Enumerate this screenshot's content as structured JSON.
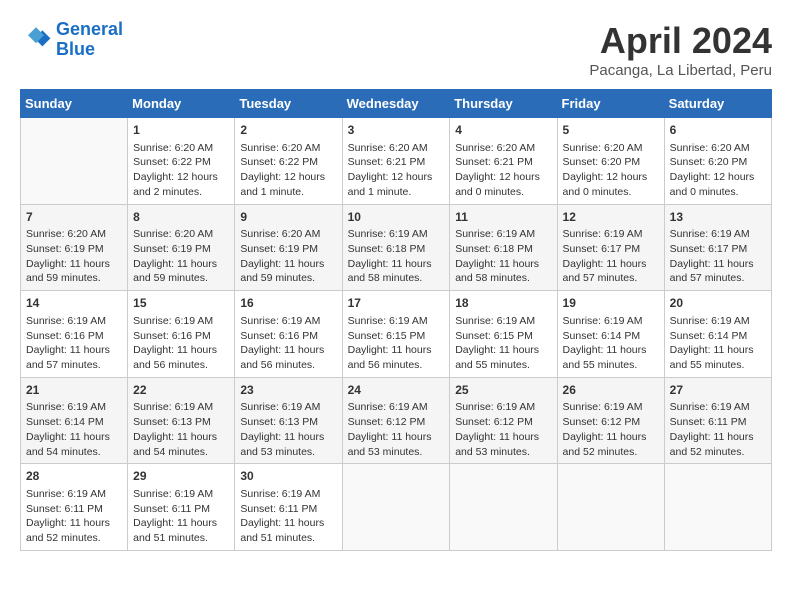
{
  "header": {
    "logo_line1": "General",
    "logo_line2": "Blue",
    "month": "April 2024",
    "location": "Pacanga, La Libertad, Peru"
  },
  "weekdays": [
    "Sunday",
    "Monday",
    "Tuesday",
    "Wednesday",
    "Thursday",
    "Friday",
    "Saturday"
  ],
  "weeks": [
    [
      {
        "day": "",
        "info": ""
      },
      {
        "day": "1",
        "info": "Sunrise: 6:20 AM\nSunset: 6:22 PM\nDaylight: 12 hours\nand 2 minutes."
      },
      {
        "day": "2",
        "info": "Sunrise: 6:20 AM\nSunset: 6:22 PM\nDaylight: 12 hours\nand 1 minute."
      },
      {
        "day": "3",
        "info": "Sunrise: 6:20 AM\nSunset: 6:21 PM\nDaylight: 12 hours\nand 1 minute."
      },
      {
        "day": "4",
        "info": "Sunrise: 6:20 AM\nSunset: 6:21 PM\nDaylight: 12 hours\nand 0 minutes."
      },
      {
        "day": "5",
        "info": "Sunrise: 6:20 AM\nSunset: 6:20 PM\nDaylight: 12 hours\nand 0 minutes."
      },
      {
        "day": "6",
        "info": "Sunrise: 6:20 AM\nSunset: 6:20 PM\nDaylight: 12 hours\nand 0 minutes."
      }
    ],
    [
      {
        "day": "7",
        "info": "Sunrise: 6:20 AM\nSunset: 6:19 PM\nDaylight: 11 hours\nand 59 minutes."
      },
      {
        "day": "8",
        "info": "Sunrise: 6:20 AM\nSunset: 6:19 PM\nDaylight: 11 hours\nand 59 minutes."
      },
      {
        "day": "9",
        "info": "Sunrise: 6:20 AM\nSunset: 6:19 PM\nDaylight: 11 hours\nand 59 minutes."
      },
      {
        "day": "10",
        "info": "Sunrise: 6:19 AM\nSunset: 6:18 PM\nDaylight: 11 hours\nand 58 minutes."
      },
      {
        "day": "11",
        "info": "Sunrise: 6:19 AM\nSunset: 6:18 PM\nDaylight: 11 hours\nand 58 minutes."
      },
      {
        "day": "12",
        "info": "Sunrise: 6:19 AM\nSunset: 6:17 PM\nDaylight: 11 hours\nand 57 minutes."
      },
      {
        "day": "13",
        "info": "Sunrise: 6:19 AM\nSunset: 6:17 PM\nDaylight: 11 hours\nand 57 minutes."
      }
    ],
    [
      {
        "day": "14",
        "info": "Sunrise: 6:19 AM\nSunset: 6:16 PM\nDaylight: 11 hours\nand 57 minutes."
      },
      {
        "day": "15",
        "info": "Sunrise: 6:19 AM\nSunset: 6:16 PM\nDaylight: 11 hours\nand 56 minutes."
      },
      {
        "day": "16",
        "info": "Sunrise: 6:19 AM\nSunset: 6:16 PM\nDaylight: 11 hours\nand 56 minutes."
      },
      {
        "day": "17",
        "info": "Sunrise: 6:19 AM\nSunset: 6:15 PM\nDaylight: 11 hours\nand 56 minutes."
      },
      {
        "day": "18",
        "info": "Sunrise: 6:19 AM\nSunset: 6:15 PM\nDaylight: 11 hours\nand 55 minutes."
      },
      {
        "day": "19",
        "info": "Sunrise: 6:19 AM\nSunset: 6:14 PM\nDaylight: 11 hours\nand 55 minutes."
      },
      {
        "day": "20",
        "info": "Sunrise: 6:19 AM\nSunset: 6:14 PM\nDaylight: 11 hours\nand 55 minutes."
      }
    ],
    [
      {
        "day": "21",
        "info": "Sunrise: 6:19 AM\nSunset: 6:14 PM\nDaylight: 11 hours\nand 54 minutes."
      },
      {
        "day": "22",
        "info": "Sunrise: 6:19 AM\nSunset: 6:13 PM\nDaylight: 11 hours\nand 54 minutes."
      },
      {
        "day": "23",
        "info": "Sunrise: 6:19 AM\nSunset: 6:13 PM\nDaylight: 11 hours\nand 53 minutes."
      },
      {
        "day": "24",
        "info": "Sunrise: 6:19 AM\nSunset: 6:12 PM\nDaylight: 11 hours\nand 53 minutes."
      },
      {
        "day": "25",
        "info": "Sunrise: 6:19 AM\nSunset: 6:12 PM\nDaylight: 11 hours\nand 53 minutes."
      },
      {
        "day": "26",
        "info": "Sunrise: 6:19 AM\nSunset: 6:12 PM\nDaylight: 11 hours\nand 52 minutes."
      },
      {
        "day": "27",
        "info": "Sunrise: 6:19 AM\nSunset: 6:11 PM\nDaylight: 11 hours\nand 52 minutes."
      }
    ],
    [
      {
        "day": "28",
        "info": "Sunrise: 6:19 AM\nSunset: 6:11 PM\nDaylight: 11 hours\nand 52 minutes."
      },
      {
        "day": "29",
        "info": "Sunrise: 6:19 AM\nSunset: 6:11 PM\nDaylight: 11 hours\nand 51 minutes."
      },
      {
        "day": "30",
        "info": "Sunrise: 6:19 AM\nSunset: 6:11 PM\nDaylight: 11 hours\nand 51 minutes."
      },
      {
        "day": "",
        "info": ""
      },
      {
        "day": "",
        "info": ""
      },
      {
        "day": "",
        "info": ""
      },
      {
        "day": "",
        "info": ""
      }
    ]
  ]
}
